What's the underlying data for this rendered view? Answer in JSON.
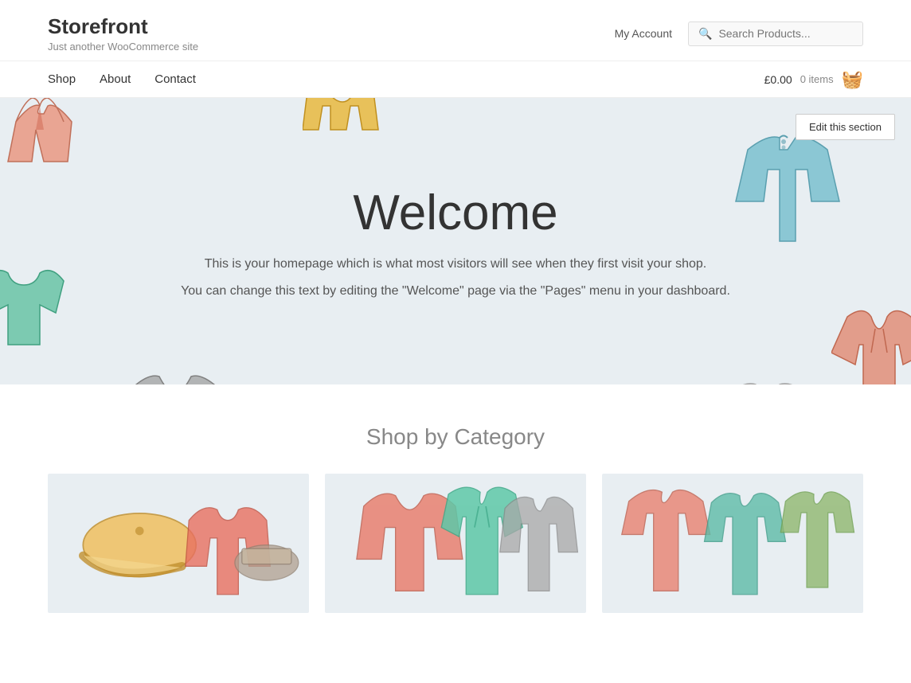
{
  "site": {
    "title": "Storefront",
    "tagline": "Just another WooCommerce site"
  },
  "header": {
    "my_account_label": "My Account",
    "search_placeholder": "Search Products...",
    "cart_price": "£0.00",
    "cart_count": "0 items"
  },
  "nav": {
    "links": [
      {
        "label": "Shop",
        "href": "#"
      },
      {
        "label": "About",
        "href": "#"
      },
      {
        "label": "Contact",
        "href": "#"
      }
    ]
  },
  "hero": {
    "title": "Welcome",
    "text1": "This is your homepage which is what most visitors will see when they first visit your shop.",
    "text2": "You can change this text by editing the \"Welcome\" page via the \"Pages\" menu in your dashboard.",
    "edit_label": "Edit this section"
  },
  "shop": {
    "section_title": "Shop by Category"
  }
}
